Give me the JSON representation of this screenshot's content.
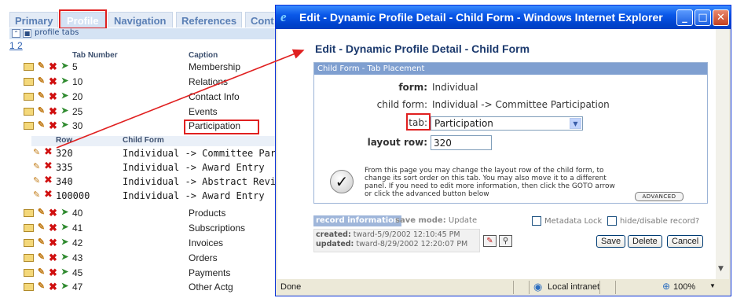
{
  "tabs": [
    "Primary",
    "Profile",
    "Navigation",
    "References",
    "Cont"
  ],
  "subbar": {
    "label": "profile tabs"
  },
  "pager": "1 2",
  "columns": {
    "tab_number": "Tab Number",
    "caption": "Caption"
  },
  "child_columns": {
    "row": "Row",
    "child_form": "Child Form"
  },
  "rows_top": [
    {
      "num": "5",
      "caption": "Membership"
    },
    {
      "num": "10",
      "caption": "Relations"
    },
    {
      "num": "20",
      "caption": "Contact Info"
    },
    {
      "num": "25",
      "caption": "Events"
    },
    {
      "num": "30",
      "caption": "Participation"
    }
  ],
  "child_rows": [
    {
      "row": "320",
      "form": "Individual -> Committee Participa"
    },
    {
      "row": "335",
      "form": "Individual -> Award Entry"
    },
    {
      "row": "340",
      "form": "Individual -> Abstract Reviewer C"
    },
    {
      "row": "100000",
      "form": "Individual -> Award Entry"
    }
  ],
  "rows_bottom": [
    {
      "num": "40",
      "caption": "Products"
    },
    {
      "num": "41",
      "caption": "Subscriptions"
    },
    {
      "num": "42",
      "caption": "Invoices"
    },
    {
      "num": "43",
      "caption": "Orders"
    },
    {
      "num": "45",
      "caption": "Payments"
    },
    {
      "num": "47",
      "caption": "Other Actg"
    }
  ],
  "window": {
    "title": "Edit - Dynamic Profile Detail - Child Form - Windows Internet Explorer",
    "heading": "Edit - Dynamic Profile Detail - Child Form",
    "panel_header": "Child Form - Tab Placement",
    "form_label": "form:",
    "form_value": "Individual",
    "child_form_label": "child form:",
    "child_form_value": "Individual -> Committee Participation",
    "tab_label": "tab:",
    "tab_value": "Participation",
    "layout_row_label": "layout row:",
    "layout_row_value": "320",
    "help_text": "From this page you may change the layout row of the child form, to change its sort order on this tab. You may also move it to a different panel. If you need to edit more information, then click the GOTO arrow or click the advanced button below",
    "advanced_label": "ADVANCED",
    "record_info": "record information",
    "save_mode_label": "save mode:",
    "save_mode_value": "Update",
    "metadata_lock": "Metadata Lock",
    "hide_disable": "hide/disable record?",
    "created_label": "created:",
    "created_value": "tward-5/9/2002 12:10:45 PM",
    "updated_label": "updated:",
    "updated_value": "tward-8/29/2002 12:20:07 PM",
    "save": "Save",
    "delete": "Delete",
    "cancel": "Cancel"
  },
  "status": {
    "left": "Done",
    "zone": "Local intranet",
    "zoom": "100%"
  },
  "colors": {
    "titlebar": "#0a58e8",
    "highlight": "#e02020",
    "tab_text": "#5a7fb5"
  }
}
